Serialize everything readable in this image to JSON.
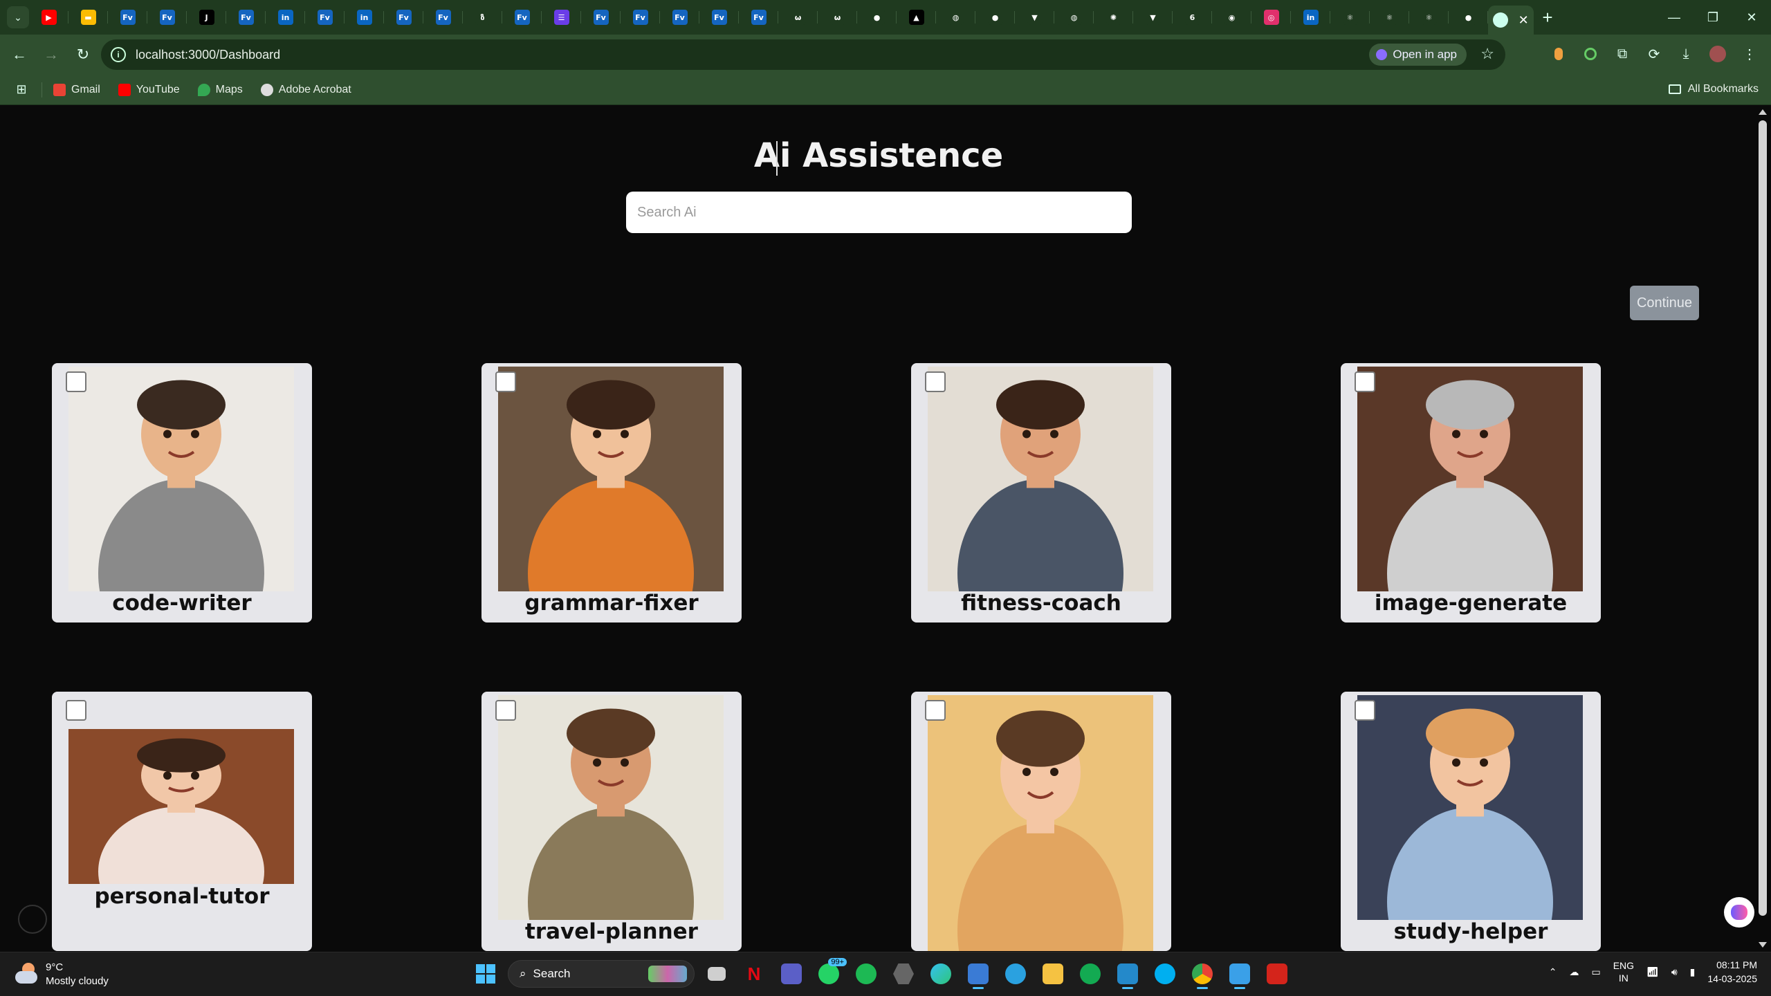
{
  "browser": {
    "url": "localhost:3000/Dashboard",
    "open_in_app": "Open in app",
    "tabs": [
      {
        "icon": "youtube-icon",
        "color": "#ff0000",
        "glyph": "▶"
      },
      {
        "icon": "keep-icon",
        "color": "#fbbc04",
        "glyph": "▬"
      },
      {
        "icon": "fv-icon",
        "color": "#1565c0",
        "glyph": "Fv"
      },
      {
        "icon": "fv-icon",
        "color": "#1565c0",
        "glyph": "Fv"
      },
      {
        "icon": "j-icon",
        "color": "#000000",
        "glyph": "J"
      },
      {
        "icon": "fv-icon",
        "color": "#1565c0",
        "glyph": "Fv"
      },
      {
        "icon": "linkedin-icon",
        "color": "#0a66c2",
        "glyph": "in"
      },
      {
        "icon": "fv-icon",
        "color": "#1565c0",
        "glyph": "Fv"
      },
      {
        "icon": "linkedin-icon",
        "color": "#0a66c2",
        "glyph": "in"
      },
      {
        "icon": "fv-icon",
        "color": "#1565c0",
        "glyph": "Fv"
      },
      {
        "icon": "fv-icon",
        "color": "#1565c0",
        "glyph": "Fv"
      },
      {
        "icon": "leaf-icon",
        "color": "#1f3a1f",
        "glyph": "ზ"
      },
      {
        "icon": "fv-icon",
        "color": "#1565c0",
        "glyph": "Fv"
      },
      {
        "icon": "list-icon",
        "color": "#6a3de8",
        "glyph": "☰"
      },
      {
        "icon": "fv-icon",
        "color": "#1565c0",
        "glyph": "Fv"
      },
      {
        "icon": "fv-icon",
        "color": "#1565c0",
        "glyph": "Fv"
      },
      {
        "icon": "fv-icon",
        "color": "#1565c0",
        "glyph": "Fv"
      },
      {
        "icon": "fv-icon",
        "color": "#1565c0",
        "glyph": "Fv"
      },
      {
        "icon": "fv-icon",
        "color": "#1565c0",
        "glyph": "Fv"
      },
      {
        "icon": "wave-icon",
        "color": "#1f3a1f",
        "glyph": "ω"
      },
      {
        "icon": "wave-icon",
        "color": "#1f3a1f",
        "glyph": "ω"
      },
      {
        "icon": "github-icon",
        "color": "#1f3a1f",
        "glyph": "●"
      },
      {
        "icon": "vercel-icon",
        "color": "#000000",
        "glyph": "▲"
      },
      {
        "icon": "globe-icon",
        "color": "#1f3a1f",
        "glyph": "◍"
      },
      {
        "icon": "github-icon",
        "color": "#1f3a1f",
        "glyph": "●"
      },
      {
        "icon": "vite-icon",
        "color": "#1f3a1f",
        "glyph": "▼"
      },
      {
        "icon": "globe-icon",
        "color": "#1f3a1f",
        "glyph": "◍"
      },
      {
        "icon": "openai-icon",
        "color": "#1f3a1f",
        "glyph": "✺"
      },
      {
        "icon": "vite-icon",
        "color": "#1f3a1f",
        "glyph": "▼"
      },
      {
        "icon": "six-icon",
        "color": "#1f3a1f",
        "glyph": "6"
      },
      {
        "icon": "chrome-icon",
        "color": "#1f3a1f",
        "glyph": "◉"
      },
      {
        "icon": "instagram-icon",
        "color": "#e1306c",
        "glyph": "◎"
      },
      {
        "icon": "linkedin-icon",
        "color": "#0a66c2",
        "glyph": "in"
      },
      {
        "icon": "react-icon",
        "color": "#1f3a1f",
        "glyph": "⚛"
      },
      {
        "icon": "react-icon",
        "color": "#1f3a1f",
        "glyph": "⚛"
      },
      {
        "icon": "react-icon",
        "color": "#1f3a1f",
        "glyph": "⚛"
      },
      {
        "icon": "github-icon",
        "color": "#1f3a1f",
        "glyph": "●"
      }
    ]
  },
  "bookmarks": [
    {
      "label": "Gmail",
      "color": "#ea4335"
    },
    {
      "label": "YouTube",
      "color": "#ff0000"
    },
    {
      "label": "Maps",
      "color": "#34a853"
    },
    {
      "label": "Adobe Acrobat",
      "color": "#dddddd"
    }
  ],
  "all_bookmarks": "All Bookmarks",
  "page": {
    "title": "Ai Assistence",
    "search_placeholder": "Search Ai",
    "continue_label": "Continue"
  },
  "cards": [
    {
      "label": "code-writer",
      "name": "card-code-writer",
      "bg": "#ece9e4",
      "shirt": "#8a8a8a",
      "hair": "#3a2a20",
      "skin": "#e8b48a"
    },
    {
      "label": "grammar-fixer",
      "name": "card-grammar-fixer",
      "bg": "#6b5440",
      "shirt": "#e07a2a",
      "hair": "#3a2418",
      "skin": "#f0c19a"
    },
    {
      "label": "fitness-coach",
      "name": "card-fitness-coach",
      "bg": "#e3ddd4",
      "shirt": "#4a5566",
      "hair": "#3a2418",
      "skin": "#e0a27a"
    },
    {
      "label": "image-generate",
      "name": "card-image-generate",
      "bg": "#5a3828",
      "shirt": "#cfcfcf",
      "hair": "#b8b8b8",
      "skin": "#dfa58a"
    },
    {
      "label": "personal-tutor",
      "name": "card-personal-tutor",
      "bg": "#8a4a2a",
      "shirt": "#f0e0d8",
      "hair": "#3a2418",
      "skin": "#f1c7a8"
    },
    {
      "label": "travel-planner",
      "name": "card-travel-planner",
      "bg": "#e7e4da",
      "shirt": "#8a7a5a",
      "hair": "#5a3a24",
      "skin": "#d89a70"
    },
    {
      "label": "",
      "name": "card-selfie-assistant",
      "bg": "#ecc27a",
      "shirt": "#e2a560",
      "hair": "#5a3a24",
      "skin": "#f4c6a4"
    },
    {
      "label": "study-helper",
      "name": "card-study-helper",
      "bg": "#3a4258",
      "shirt": "#9cb8d8",
      "hair": "#e0a060",
      "skin": "#f2c4a0"
    }
  ],
  "taskbar": {
    "temp": "9°C",
    "weather": "Mostly cloudy",
    "search": "Search",
    "lang_top": "ENG",
    "lang_bottom": "IN",
    "time": "08:11 PM",
    "date": "14-03-2025",
    "notif_badge": "99+"
  }
}
